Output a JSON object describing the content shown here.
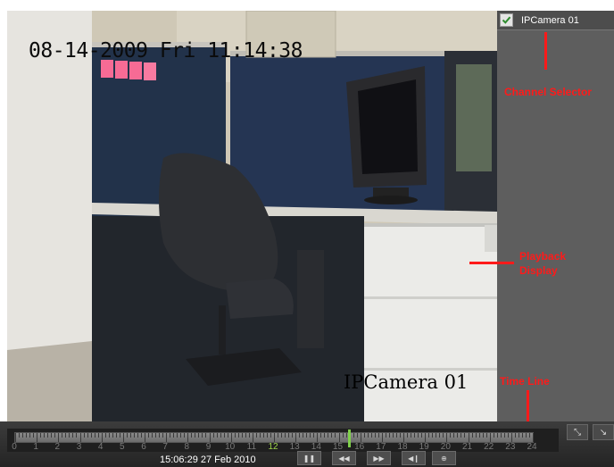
{
  "osd": {
    "datetime": "08-14-2009 Fri 11:14:38",
    "camera_label": "IPCamera 01"
  },
  "channel_selector": {
    "channel_name": "IPCamera 01",
    "checked": true
  },
  "annotations": {
    "channel_selector": "Channel Selector",
    "playback_display_line1": "Playback",
    "playback_display_line2": "Display",
    "time_line": "Time Line"
  },
  "timeline": {
    "hours": [
      "0",
      "1",
      "2",
      "3",
      "4",
      "5",
      "6",
      "7",
      "8",
      "9",
      "10",
      "11",
      "12",
      "13",
      "14",
      "15",
      "16",
      "17",
      "18",
      "19",
      "20",
      "21",
      "22",
      "23",
      "24"
    ],
    "highlighted_hour": "12",
    "current_time": "15:06:29  27 Feb 2010"
  },
  "controls": {
    "icons": [
      "pause-icon",
      "rewind-icon",
      "forward-icon",
      "step-back-icon",
      "zoom-icon"
    ]
  },
  "colors": {
    "annotation": "#ff1a1a",
    "cursor": "#7fd04a",
    "panel_bg": "#5e5e5e"
  }
}
